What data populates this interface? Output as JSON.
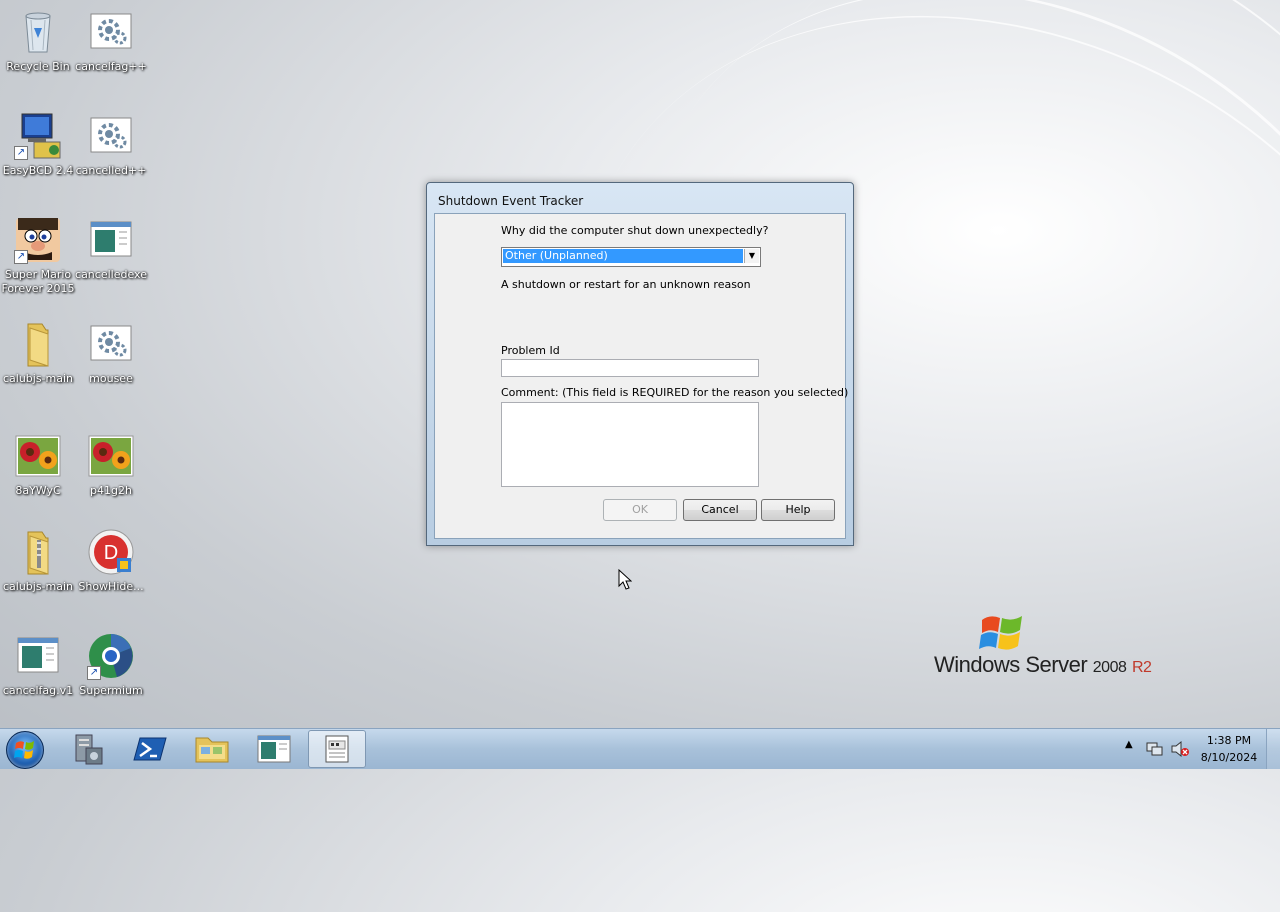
{
  "desktop": {
    "icons": [
      {
        "label": "Recycle Bin",
        "icon": "recycle-bin-icon"
      },
      {
        "label": "cancelfag++",
        "icon": "gear-settings-icon"
      },
      {
        "label": "EasyBCD 2.4",
        "icon": "easybcd-icon"
      },
      {
        "label": "cancelled++",
        "icon": "gear-settings-icon"
      },
      {
        "label": "Super Mario Forever 2015",
        "icon": "mario-icon"
      },
      {
        "label": "cancelledexe",
        "icon": "window-app-icon"
      },
      {
        "label": "calubjs-main",
        "icon": "folder-icon"
      },
      {
        "label": "mousee",
        "icon": "gear-settings-icon"
      },
      {
        "label": "8aYWyC",
        "icon": "flower-image-icon"
      },
      {
        "label": "p41g2h",
        "icon": "flower-image-icon"
      },
      {
        "label": "calubjs-main",
        "icon": "zip-folder-icon"
      },
      {
        "label": "ShowHide...",
        "icon": "showhide-icon"
      },
      {
        "label": "cancelfag.v1",
        "icon": "window-app-icon"
      },
      {
        "label": "Supermium",
        "icon": "supermium-icon"
      }
    ]
  },
  "dialog": {
    "title": "Shutdown Event Tracker",
    "question": "Why did the computer shut down unexpectedly?",
    "reason_selected": "Other (Unplanned)",
    "reason_description": "A shutdown or restart for an unknown reason",
    "problem_id_label": "Problem Id",
    "problem_id_value": "",
    "comment_label": "Comment: (This field is REQUIRED for the reason you selected)",
    "comment_value": "",
    "ok_label": "OK",
    "cancel_label": "Cancel",
    "help_label": "Help"
  },
  "branding": {
    "product": "Windows Server",
    "version": "2008",
    "edition": "R2"
  },
  "taskbar": {
    "pinned": [
      "server-manager-icon",
      "powershell-icon",
      "explorer-folder-icon",
      "window-app-icon",
      "shutdown-tracker-icon"
    ],
    "time": "1:38 PM",
    "date": "8/10/2024"
  },
  "colors": {
    "selection": "#3399ff",
    "taskbar": "#a8c1da",
    "r2_accent": "#c0392b"
  }
}
